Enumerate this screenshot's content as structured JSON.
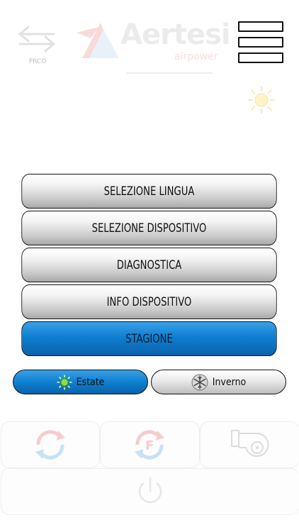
{
  "header": {
    "brand_name": "Aertesi",
    "brand_sub": "airpower",
    "swap_label": "PRCO"
  },
  "menu": {
    "items": [
      {
        "label": "SELEZIONE LINGUA",
        "active": false
      },
      {
        "label": "SELEZIONE DISPOSITIVO",
        "active": false
      },
      {
        "label": "DIAGNOSTICA",
        "active": false
      },
      {
        "label": "INFO DISPOSITIVO",
        "active": false
      },
      {
        "label": "STAGIONE",
        "active": true
      }
    ]
  },
  "season": {
    "summer_label": "Estate",
    "winter_label": "Inverno",
    "selected": "Estate"
  },
  "colors": {
    "accent": "#0e7fd0",
    "menu_gray": "#c9c9c9",
    "sun": "#7fd42a",
    "text": "#111111"
  },
  "icons": {
    "header": [
      "swap-arrows-icon",
      "hamburger-menu-icon",
      "sun-icon"
    ],
    "tiles": [
      "refresh-icon",
      "filter-refresh-icon",
      "fan-unit-icon",
      "power-icon"
    ],
    "season": [
      "sun-icon",
      "snowflake-icon"
    ]
  }
}
